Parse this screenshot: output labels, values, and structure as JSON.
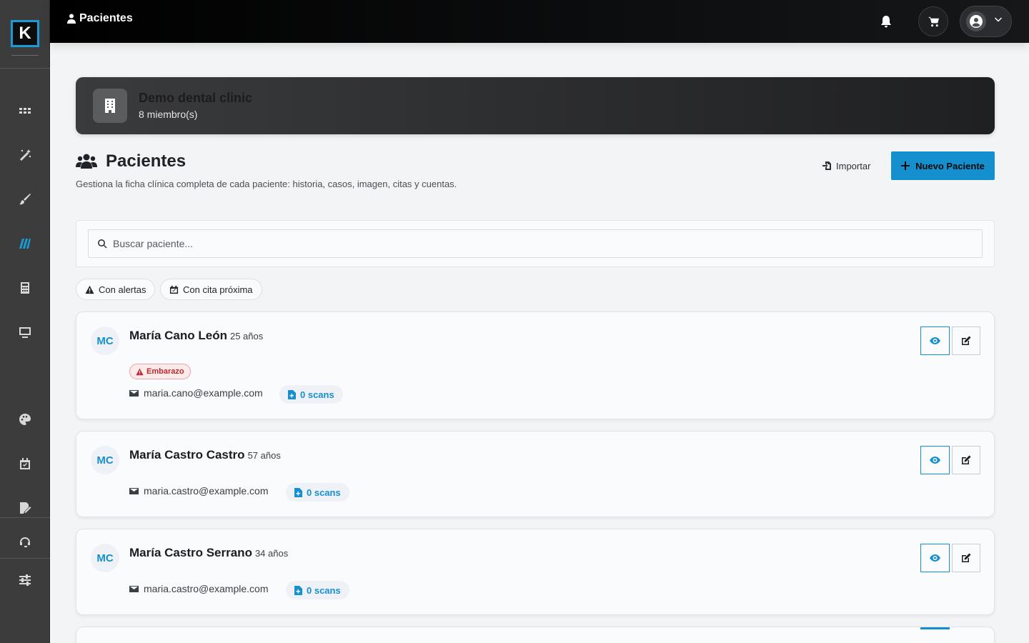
{
  "app": {
    "logo_letter": "K",
    "accent_color": "#168fcf"
  },
  "sidebar": {
    "items": [
      {
        "name": "dashboard",
        "icon": "grid-icon"
      },
      {
        "name": "magic",
        "icon": "magic-wand-icon"
      },
      {
        "name": "design",
        "icon": "paintbrush-icon"
      },
      {
        "name": "brand",
        "icon": "stripes-logo-icon"
      },
      {
        "name": "calculator",
        "icon": "calculator-icon"
      },
      {
        "name": "screen",
        "icon": "monitor-icon"
      },
      {
        "name": "palette",
        "icon": "palette-icon"
      },
      {
        "name": "calendar",
        "icon": "calendar-check-icon"
      },
      {
        "name": "signature",
        "icon": "file-signature-icon"
      },
      {
        "name": "support",
        "icon": "headset-icon"
      },
      {
        "name": "settings",
        "icon": "sliders-icon"
      }
    ]
  },
  "topbar": {
    "title": "Pacientes",
    "title_icon": "user-doctor-icon",
    "bell_icon": "bell-icon",
    "cart_icon": "cart-icon",
    "user_icon": "user-circle-icon"
  },
  "clinic": {
    "name": "Demo dental clinic",
    "members": "8 miembro(s)"
  },
  "page": {
    "title": "Pacientes",
    "description": "Gestiona la ficha clínica completa de cada paciente: historia, casos, imagen, citas y cuentas.",
    "import_label": "Importar",
    "new_label": "Nuevo Paciente"
  },
  "search": {
    "placeholder": "Buscar paciente..."
  },
  "filters": {
    "alerts_label": "Con alertas",
    "upcoming_label": "Con cita próxima"
  },
  "patients": [
    {
      "initials": "MC",
      "name": "María Cano León",
      "age": "25 años",
      "alert": "Embarazo",
      "email": "maria.cano@example.com",
      "scans": "0 scans"
    },
    {
      "initials": "MC",
      "name": "María Castro Castro",
      "age": "57 años",
      "email": "maria.castro@example.com",
      "scans": "0 scans"
    },
    {
      "initials": "MC",
      "name": "María Castro Serrano",
      "age": "34 años",
      "email": "maria.castro@example.com",
      "scans": "0 scans"
    }
  ]
}
